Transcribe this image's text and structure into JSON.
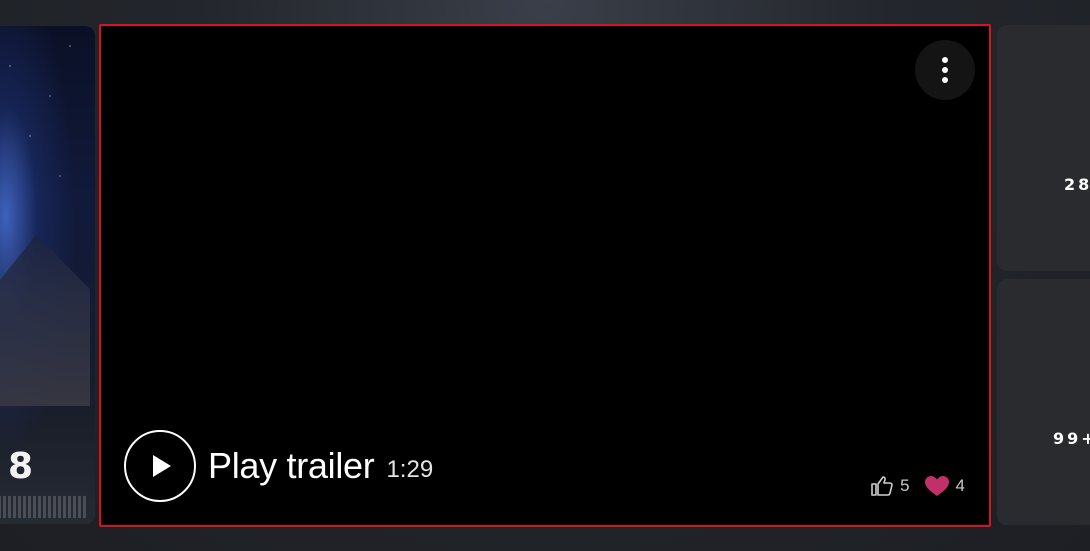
{
  "poster": {
    "number": "8"
  },
  "player": {
    "play_label": "Play trailer",
    "duration": "1:29",
    "likes": "5",
    "loves": "4",
    "accent_border_color": "#d4161c",
    "love_color": "#c2306a"
  },
  "side": {
    "card1_count": "28",
    "card2_count": "99+"
  }
}
